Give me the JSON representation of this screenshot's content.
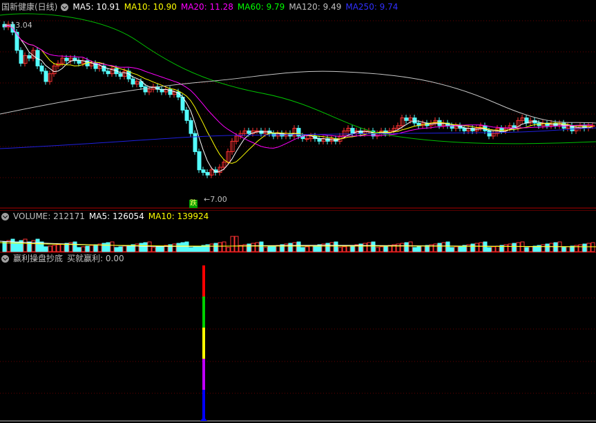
{
  "main": {
    "title": "国新健康(日线)",
    "ma": [
      {
        "label": "MA5: 10.91",
        "color": "#ffffff"
      },
      {
        "label": "MA10: 10.90",
        "color": "#ffff00"
      },
      {
        "label": "MA20: 11.28",
        "color": "#ff00ff"
      },
      {
        "label": "MA60: 9.79",
        "color": "#00ff00"
      },
      {
        "label": "MA120: 9.49",
        "color": "#c0c0c0"
      },
      {
        "label": "MA250: 9.74",
        "color": "#3030ff"
      }
    ],
    "high_label": "13.04",
    "low_label": "7.00",
    "marker": "跌"
  },
  "volume": {
    "labels": [
      {
        "label": "VOLUME: 212171",
        "color": "#c0c0c0"
      },
      {
        "label": "MA5: 126054",
        "color": "#ffffff"
      },
      {
        "label": "MA10: 139924",
        "color": "#ffff00"
      }
    ]
  },
  "indicator": {
    "title": "赢利操盘抄底",
    "value_label": "买就赢利: 0.00"
  },
  "colors": {
    "up": "#ff3232",
    "down": "#54fcfc",
    "grid": "#b00000",
    "background": "#000000"
  }
}
